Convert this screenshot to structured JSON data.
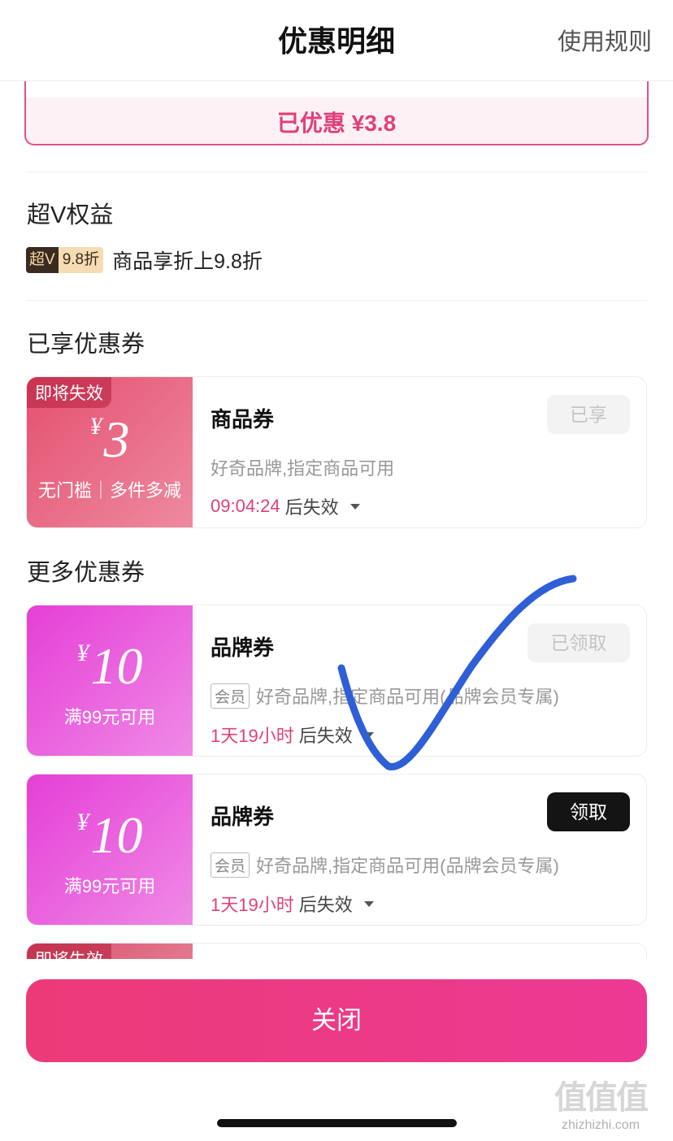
{
  "header": {
    "title": "优惠明细",
    "rules_link": "使用规则"
  },
  "summary": {
    "saved_text": "已优惠 ¥3.8"
  },
  "super_v": {
    "section_title": "超V权益",
    "badge_left": "超V",
    "badge_right": "9.8折",
    "description": "商品享折上9.8折"
  },
  "enjoyed": {
    "section_title": "已享优惠券",
    "coupon": {
      "tag": "即将失效",
      "currency": "¥",
      "amount": "3",
      "condition": "无门槛｜多件多减",
      "name": "商品券",
      "description": "好奇品牌,指定商品可用",
      "expiry_time": "09:04:24",
      "expiry_suffix": "后失效",
      "button": "已享"
    }
  },
  "more": {
    "section_title": "更多优惠券",
    "coupons": [
      {
        "currency": "¥",
        "amount": "10",
        "condition": "满99元可用",
        "name": "品牌券",
        "member_tag": "会员",
        "description": "好奇品牌,指定商品可用(品牌会员专属)",
        "expiry_time": "1天19小时",
        "expiry_suffix": "后失效",
        "button": "已领取"
      },
      {
        "currency": "¥",
        "amount": "10",
        "condition": "满99元可用",
        "name": "品牌券",
        "member_tag": "会员",
        "description": "好奇品牌,指定商品可用(品牌会员专属)",
        "expiry_time": "1天19小时",
        "expiry_suffix": "后失效",
        "button": "领取"
      }
    ],
    "partial_tag": "即将失效"
  },
  "footer": {
    "close_label": "关闭"
  },
  "watermark": {
    "logo": "值值值",
    "site": "zhizhizhi.com"
  },
  "colors": {
    "accent": "#e0407a",
    "close_button": "#ec3a80",
    "check_stroke": "#2f5fd6"
  }
}
